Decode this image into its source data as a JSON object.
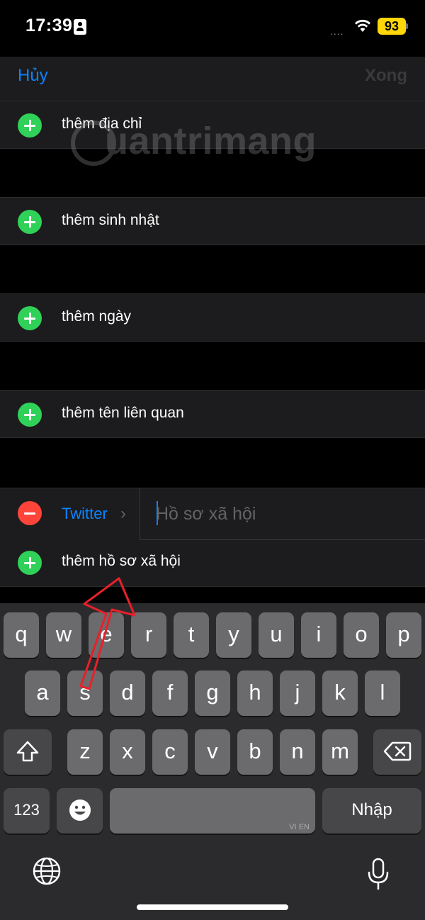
{
  "status_bar": {
    "time": "17:39",
    "signal_dots": "....",
    "battery_level": "93"
  },
  "nav": {
    "cancel_label": "Hủy",
    "done_label": "Xong"
  },
  "rows": {
    "add_address": "thêm địa chỉ",
    "add_birthday": "thêm sinh nhật",
    "add_date": "thêm ngày",
    "add_related_name": "thêm tên liên quan"
  },
  "social": {
    "service_label": "Twitter",
    "chevron": "›",
    "placeholder": "Hồ sơ xã hội",
    "add_label": "thêm hồ sơ xã hội"
  },
  "watermark": {
    "text": "uantrimang"
  },
  "keyboard": {
    "row1": [
      "q",
      "w",
      "e",
      "r",
      "t",
      "y",
      "u",
      "i",
      "o",
      "p"
    ],
    "row2": [
      "a",
      "s",
      "d",
      "f",
      "g",
      "h",
      "j",
      "k",
      "l"
    ],
    "row3": [
      "z",
      "x",
      "c",
      "v",
      "b",
      "n",
      "m"
    ],
    "numbers_label": "123",
    "return_label": "Nhập",
    "language_hint": "VI EN"
  },
  "colors": {
    "accent_blue": "#0a84ff",
    "add_green": "#30d158",
    "remove_red": "#ff453a",
    "battery_yellow": "#ffd60a",
    "annotation_red": "#e8202a"
  }
}
